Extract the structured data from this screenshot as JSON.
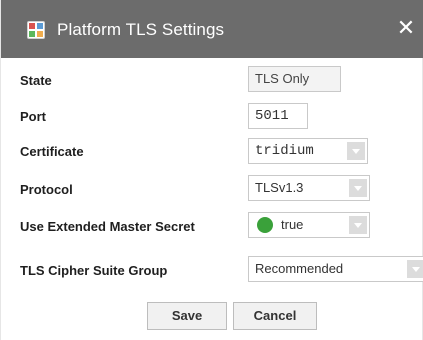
{
  "window": {
    "title": "Platform TLS Settings",
    "close_glyph": "✕"
  },
  "fields": {
    "state": {
      "label": "State",
      "value": "TLS Only"
    },
    "port": {
      "label": "Port",
      "value": "5011"
    },
    "certificate": {
      "label": "Certificate",
      "value": "tridium"
    },
    "protocol": {
      "label": "Protocol",
      "value": "TLSv1.3"
    },
    "ems": {
      "label": "Use Extended Master Secret",
      "value": "true",
      "indicator_color": "#3aa13a"
    },
    "cipher": {
      "label": "TLS Cipher Suite Group",
      "value": "Recommended"
    }
  },
  "buttons": {
    "save": "Save",
    "cancel": "Cancel"
  },
  "colors": {
    "titlebar": "#6c6c6c",
    "dropdown_button": "#dcdcdc"
  }
}
